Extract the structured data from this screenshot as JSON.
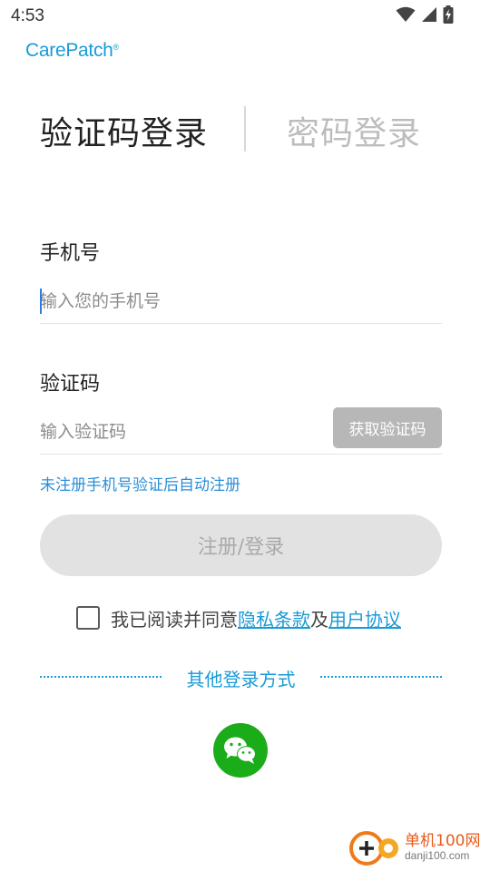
{
  "status_bar": {
    "time": "4:53",
    "icons": [
      "wifi-icon",
      "signal-icon",
      "battery-charging-icon"
    ]
  },
  "brand": {
    "name": "CarePatch",
    "mark": "®",
    "color": "#1a9ad6"
  },
  "tabs": [
    {
      "label": "验证码登录",
      "active": true
    },
    {
      "label": "密码登录",
      "active": false
    }
  ],
  "phone": {
    "label": "手机号",
    "placeholder": "输入您的手机号",
    "value": ""
  },
  "code": {
    "label": "验证码",
    "placeholder": "输入验证码",
    "value": "",
    "get_code_label": "获取验证码"
  },
  "hint": "未注册手机号验证后自动注册",
  "login_button": "注册/登录",
  "agreement": {
    "checked": false,
    "prefix": "我已阅读并同意",
    "privacy_link": "隐私条款",
    "joiner": "及",
    "terms_link": "用户协议"
  },
  "other_login": {
    "label": "其他登录方式",
    "methods": [
      "wechat-icon"
    ]
  },
  "watermark": {
    "line1": "单机100网",
    "line2": "danji100.com"
  },
  "colors": {
    "accent": "#1a9ad6",
    "wechat": "#1aad19",
    "disabled_button": "#e2e2e2",
    "get_code_button": "#b7b7b7"
  }
}
